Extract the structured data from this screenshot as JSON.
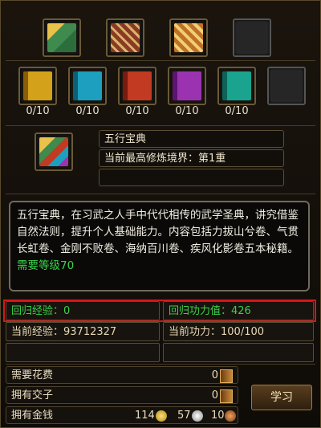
{
  "top_items": [
    {
      "icon": "green-book-stack-icon",
      "color": "#3f8a4e"
    },
    {
      "icon": "bamboo-scroll-bundle-icon",
      "color": "#8a3a24"
    },
    {
      "icon": "golden-scroll-bundle-icon",
      "color": "#c0702a"
    },
    {
      "icon": "empty-slot-icon",
      "color": "#2a2a2a"
    }
  ],
  "volumes": [
    {
      "icon": "yellow-book-icon",
      "color": "#d3a21a",
      "count": "0/10"
    },
    {
      "icon": "cyan-book-icon",
      "color": "#1d9fbf",
      "count": "0/10"
    },
    {
      "icon": "red-book-icon",
      "color": "#c23a22",
      "count": "0/10"
    },
    {
      "icon": "purple-book-icon",
      "color": "#9b33b0",
      "count": "0/10"
    },
    {
      "icon": "teal-book-icon",
      "color": "#1aa38f",
      "count": "0/10"
    },
    {
      "icon": "empty-slot-icon",
      "color": "#2a2a2a",
      "count": ""
    }
  ],
  "skill": {
    "icon": "wuxing-treasure-book-icon",
    "name": "五行宝典",
    "realm": "当前最高修炼境界：第1重",
    "extra": ""
  },
  "description": {
    "text": "五行宝典，在习武之人手中代代相传的武学圣典，讲究借鉴自然法则，提升个人基础能力。内容包括力拔山兮卷、气贯长虹卷、金刚不败卷、海纳百川卷、疾风化影卷五本秘籍。",
    "requirement": "需要等级70"
  },
  "stats": {
    "return_exp": "回归经验：0",
    "return_power": "回归功力值：426",
    "current_exp": "当前经验：93712327",
    "current_power": "当前功力：100/100"
  },
  "costs": [
    {
      "label": "需要花费",
      "value": "0",
      "icon": "jiaozi-note-icon"
    },
    {
      "label": "拥有交子",
      "value": "0",
      "icon": "jiaozi-note-icon"
    }
  ],
  "money": {
    "label": "拥有金钱",
    "gold": "114",
    "silver": "57",
    "copper": "10"
  },
  "learn_button": "学习",
  "colors": {
    "gold": "#d6a520",
    "silver": "#c8c8c8",
    "copper": "#b5652a",
    "highlight": "#d21a1a",
    "green": "#3bd14a"
  }
}
